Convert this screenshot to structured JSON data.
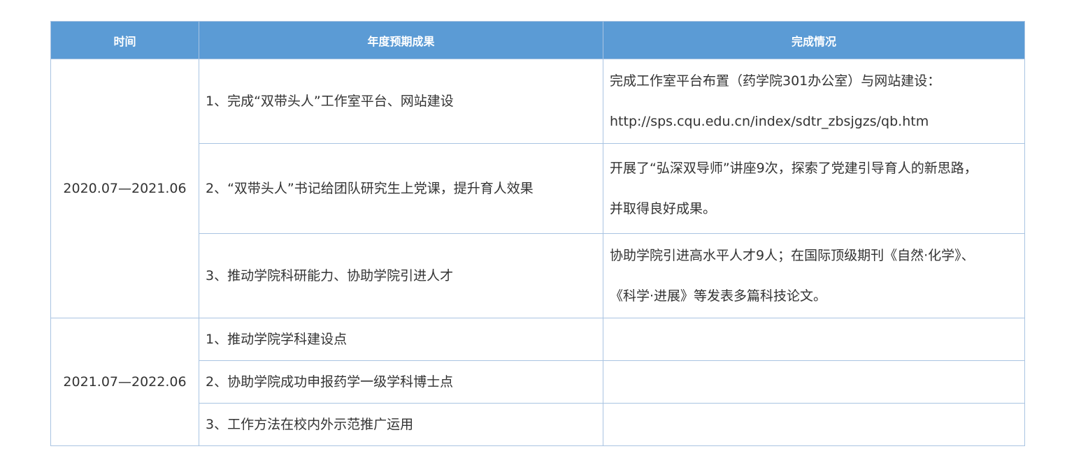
{
  "table": {
    "headers": [
      "时间",
      "年度预期成果",
      "完成情况"
    ],
    "periods": [
      {
        "time": "2020.07—2021.06",
        "rows": [
          {
            "goal": "1、完成“双带头人”工作室平台、网站建设",
            "result": [
              "完成工作室平台布置（药学院301办公室）与网站建设：",
              "http://sps.cqu.edu.cn/index/sdtr_zbsjgzs/qb.htm"
            ]
          },
          {
            "goal": "2、“双带头人”书记给团队研究生上党课，提升育人效果",
            "result": [
              "开展了“弘深双导师”讲座9次，探索了党建引导育人的新思路，",
              "并取得良好成果。"
            ]
          },
          {
            "goal": "3、推动学院科研能力、协助学院引进人才",
            "result": [
              "协助学院引进高水平人才9人；在国际顶级期刊《自然·化学》、",
              "《科学·进展》等发表多篇科技论文。"
            ]
          }
        ]
      },
      {
        "time": "2021.07—2022.06",
        "rows": [
          {
            "goal": "1、推动学院学科建设点",
            "result": []
          },
          {
            "goal": "2、协助学院成功申报药学一级学科博士点",
            "result": []
          },
          {
            "goal": "3、工作方法在校内外示范推广运用",
            "result": []
          }
        ]
      }
    ]
  }
}
